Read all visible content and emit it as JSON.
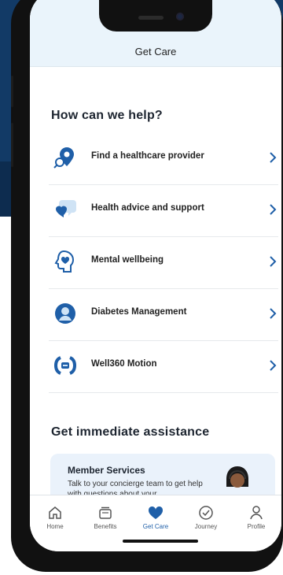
{
  "header": {
    "title": "Get Care"
  },
  "help_section": {
    "title": "How can we help?",
    "items": [
      {
        "label": "Find a healthcare provider",
        "icon": "map-pin-search-icon"
      },
      {
        "label": "Health advice and support",
        "icon": "heart-chat-icon"
      },
      {
        "label": "Mental wellbeing",
        "icon": "head-heart-icon"
      },
      {
        "label": "Diabetes Management",
        "icon": "person-badge-icon"
      },
      {
        "label": "Well360 Motion",
        "icon": "motion-icon"
      }
    ]
  },
  "assist_section": {
    "title": "Get immediate assistance",
    "card": {
      "title": "Member Services",
      "body": "Talk to your concierge team to get help with questions about your"
    }
  },
  "tabbar": {
    "tabs": [
      {
        "label": "Home",
        "icon": "home-icon"
      },
      {
        "label": "Benefits",
        "icon": "cards-icon"
      },
      {
        "label": "Get Care",
        "icon": "heart-icon",
        "active": true
      },
      {
        "label": "Journey",
        "icon": "journey-icon"
      },
      {
        "label": "Profile",
        "icon": "person-icon"
      }
    ]
  },
  "colors": {
    "accent": "#1f5fa8",
    "brand_navy": "#123a66",
    "header_bg": "#eaf4fb"
  }
}
